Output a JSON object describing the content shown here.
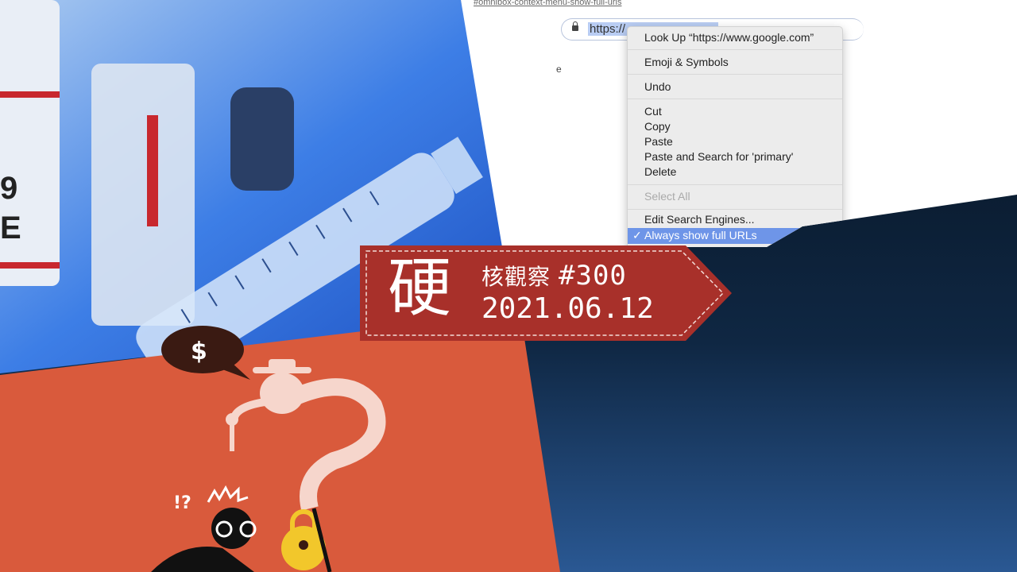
{
  "browser_screenshot": {
    "flag_link": "#omnibox-context-menu-show-full-urls",
    "omnibox_text": "https://",
    "page_text": "e",
    "context_menu": {
      "items": [
        {
          "label": "Look Up “https://www.google.com”"
        },
        {
          "label": "Emoji & Symbols"
        },
        {
          "label": "Undo"
        },
        {
          "label": "Cut"
        },
        {
          "label": "Copy"
        },
        {
          "label": "Paste"
        },
        {
          "label": "Paste and Search for 'primary'"
        },
        {
          "label": "Delete"
        },
        {
          "label": "Select All",
          "disabled": true
        },
        {
          "label": "Edit Search Engines..."
        },
        {
          "label": "Always show full URLs",
          "checked": true
        }
      ],
      "check_mark": "✓"
    }
  },
  "banner": {
    "big_char": "硬",
    "series_name": "核觀察",
    "episode": "#300",
    "date": "2021.06.12",
    "color": "#a8302a"
  },
  "colors": {
    "vaccine_bg": "#2f6fe0",
    "orange_panel": "#d95a3c",
    "navy_panel": "#0b1a2c"
  },
  "icons": [
    "lock-icon",
    "syringe-illustration",
    "vaccine-vial-illustration",
    "hacker-with-key-illustration",
    "padlock-icon",
    "dollar-speech-bubble-icon"
  ]
}
